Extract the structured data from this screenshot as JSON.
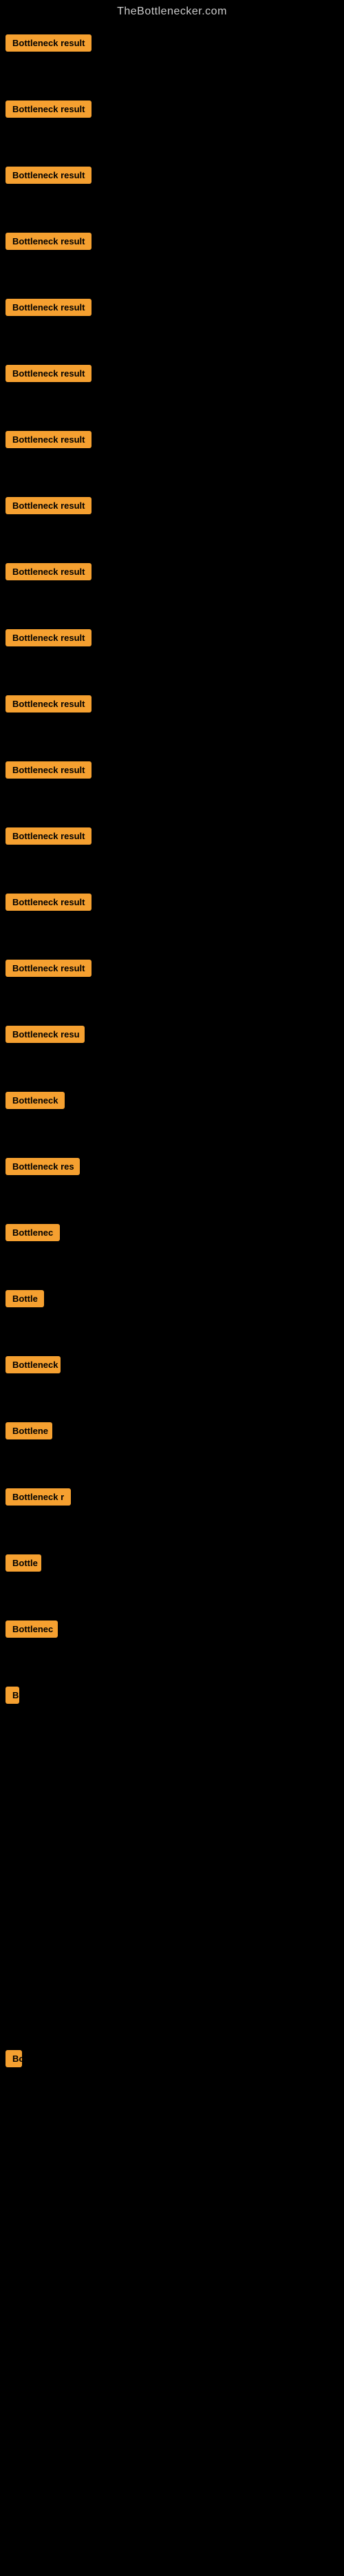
{
  "header": {
    "title": "TheBottlenecker.com"
  },
  "items": [
    {
      "id": 1,
      "label": "Bottleneck result",
      "width": 130
    },
    {
      "id": 2,
      "label": "Bottleneck result",
      "width": 130
    },
    {
      "id": 3,
      "label": "Bottleneck result",
      "width": 130
    },
    {
      "id": 4,
      "label": "Bottleneck result",
      "width": 130
    },
    {
      "id": 5,
      "label": "Bottleneck result",
      "width": 130
    },
    {
      "id": 6,
      "label": "Bottleneck result",
      "width": 130
    },
    {
      "id": 7,
      "label": "Bottleneck result",
      "width": 130
    },
    {
      "id": 8,
      "label": "Bottleneck result",
      "width": 130
    },
    {
      "id": 9,
      "label": "Bottleneck result",
      "width": 130
    },
    {
      "id": 10,
      "label": "Bottleneck result",
      "width": 130
    },
    {
      "id": 11,
      "label": "Bottleneck result",
      "width": 130
    },
    {
      "id": 12,
      "label": "Bottleneck result",
      "width": 130
    },
    {
      "id": 13,
      "label": "Bottleneck result",
      "width": 130
    },
    {
      "id": 14,
      "label": "Bottleneck result",
      "width": 130
    },
    {
      "id": 15,
      "label": "Bottleneck result",
      "width": 130
    },
    {
      "id": 16,
      "label": "Bottleneck resu",
      "width": 115
    },
    {
      "id": 17,
      "label": "Bottleneck",
      "width": 88
    },
    {
      "id": 18,
      "label": "Bottleneck res",
      "width": 108
    },
    {
      "id": 19,
      "label": "Bottlenec",
      "width": 80
    },
    {
      "id": 20,
      "label": "Bottle",
      "width": 56
    },
    {
      "id": 21,
      "label": "Bottleneck",
      "width": 80
    },
    {
      "id": 22,
      "label": "Bottlene",
      "width": 68
    },
    {
      "id": 23,
      "label": "Bottleneck r",
      "width": 96
    },
    {
      "id": 24,
      "label": "Bottle",
      "width": 52
    },
    {
      "id": 25,
      "label": "Bottlenec",
      "width": 76
    },
    {
      "id": 26,
      "label": "B",
      "width": 20
    },
    {
      "id": 27,
      "label": "",
      "width": 0
    },
    {
      "id": 28,
      "label": "",
      "width": 0
    },
    {
      "id": 29,
      "label": "",
      "width": 0
    },
    {
      "id": 30,
      "label": "",
      "width": 0
    },
    {
      "id": 31,
      "label": "Bo",
      "width": 24
    },
    {
      "id": 32,
      "label": "",
      "width": 0
    },
    {
      "id": 33,
      "label": "",
      "width": 0
    },
    {
      "id": 34,
      "label": "",
      "width": 0
    },
    {
      "id": 35,
      "label": "",
      "width": 0
    },
    {
      "id": 36,
      "label": "",
      "width": 0
    }
  ],
  "colors": {
    "badge_bg": "#f5a030",
    "badge_text": "#000000",
    "page_bg": "#000000",
    "title_color": "#cccccc"
  }
}
